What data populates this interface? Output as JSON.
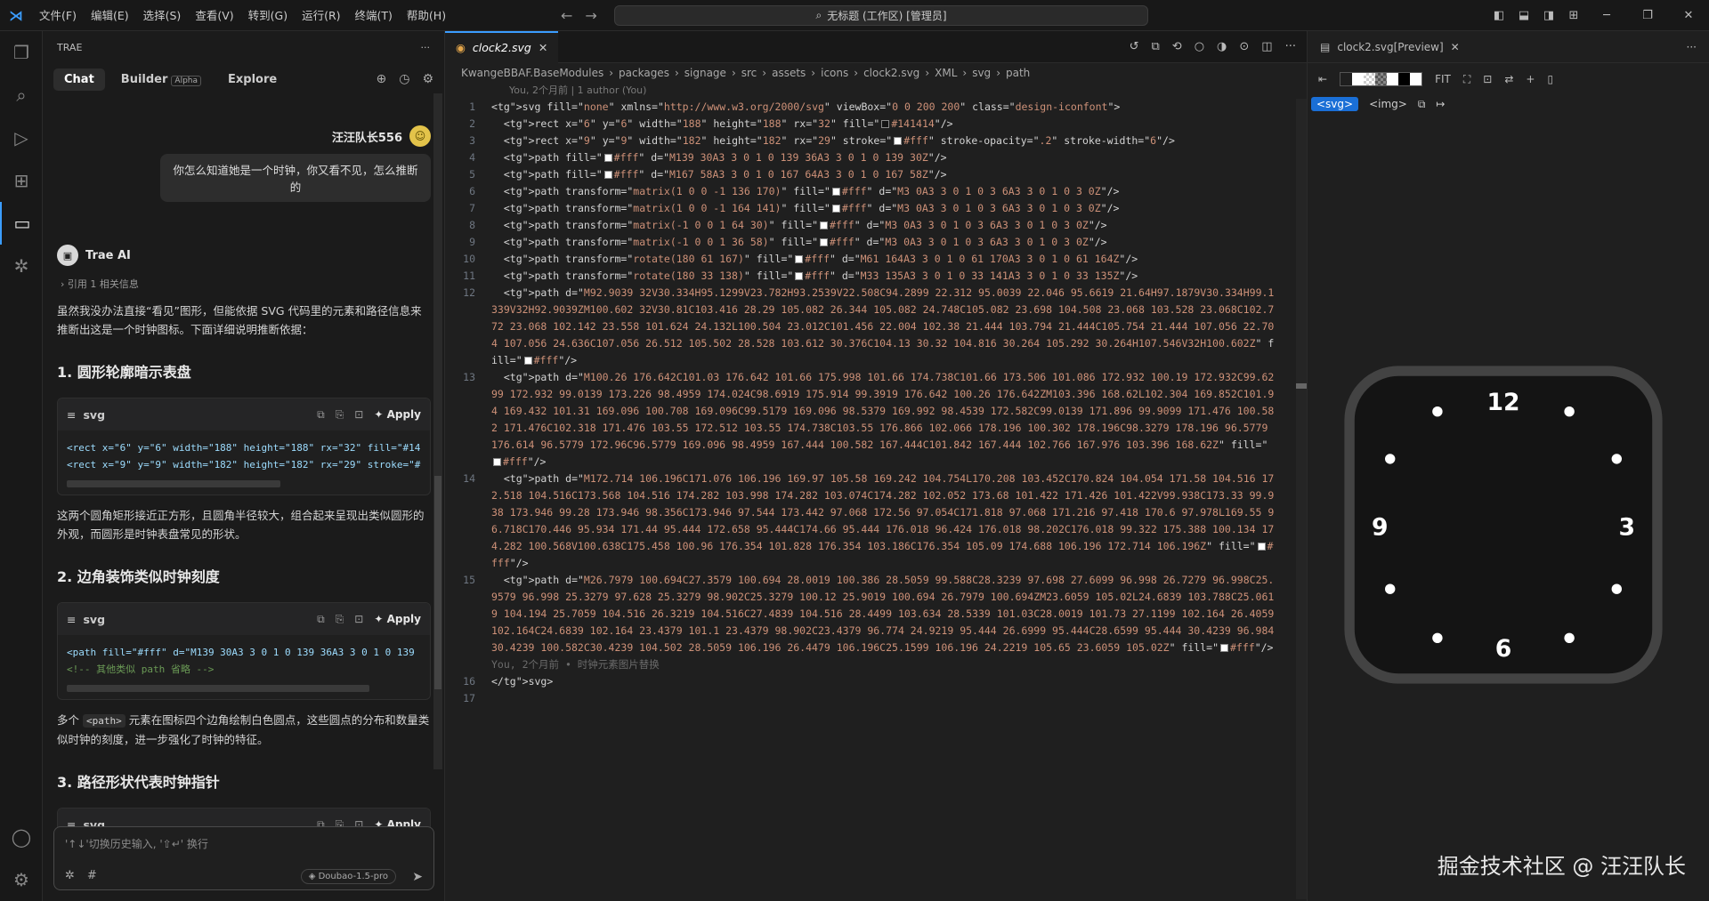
{
  "titlebar": {
    "menu": [
      "文件(F)",
      "编辑(E)",
      "选择(S)",
      "查看(V)",
      "转到(G)",
      "运行(R)",
      "终端(T)",
      "帮助(H)"
    ],
    "search": "无标题 (工作区) [管理员]",
    "search_icon": "search-icon"
  },
  "chat": {
    "header": "TRAE",
    "more": "···",
    "tabs": [
      {
        "label": "Chat"
      },
      {
        "label": "Builder",
        "badge": "Alpha"
      },
      {
        "label": "Explore"
      }
    ],
    "user_name": "汪汪队长556",
    "user_message": "你怎么知道她是一个时钟，你又看不见，怎么推断的",
    "ai_name": "Trae AI",
    "reference": "引用 1 相关信息",
    "intro": "虽然我没办法直接“看见”图形，但能依据 SVG 代码里的元素和路径信息来推断出这是一个时钟图标。下面详细说明推断依据：",
    "sections": [
      {
        "title": "1. 圆形轮廓暗示表盘",
        "lang": "svg",
        "apply": "Apply",
        "code": [
          "<rect x=\"6\" y=\"6\" width=\"188\" height=\"188\" rx=\"32\" fill=\"#14",
          "<rect x=\"9\" y=\"9\" width=\"182\" height=\"182\" rx=\"29\" stroke=\"#"
        ],
        "text": "这两个圆角矩形接近正方形，且圆角半径较大，组合起来呈现出类似圆形的外观，而圆形是时钟表盘常见的形状。"
      },
      {
        "title": "2. 边角装饰类似时钟刻度",
        "lang": "svg",
        "apply": "Apply",
        "code": [
          "<path fill=\"#fff\" d=\"M139 30A3 3 0 1 0 139 36A3 3 0 1 0 139",
          "<!-- 其他类似 path 省略 -->"
        ],
        "text_before": "多个",
        "text_code": "<path>",
        "text_after": "元素在图标四个边角绘制白色圆点，这些圆点的分布和数量类似时钟的刻度，进一步强化了时钟的特征。"
      },
      {
        "title": "3. 路径形状代表时钟指针",
        "lang": "svg",
        "apply": "Apply"
      }
    ],
    "input_placeholder": "'↑↓'切换历史输入, '⇧↵' 换行",
    "model": "Doubao-1.5-pro"
  },
  "editor": {
    "tab": "clock2.svg",
    "breadcrumb": [
      "KwangeBBAF.BaseModules",
      "packages",
      "signage",
      "src",
      "assets",
      "icons",
      "clock2.svg",
      "XML",
      "svg",
      "path"
    ],
    "blame": "You, 2个月前 | 1 author (You)",
    "inline_blame": "You, 2个月前 • 时钟元素图片替换",
    "lines": [
      "<svg fill=\"none\" xmlns=\"http://www.w3.org/2000/svg\" viewBox=\"0 0 200 200\" class=\"design-iconfont\">",
      "  <rect x=\"6\" y=\"6\" width=\"188\" height=\"188\" rx=\"32\" fill=\"#141414\"/>",
      "  <rect x=\"9\" y=\"9\" width=\"182\" height=\"182\" rx=\"29\" stroke=\"#fff\" stroke-opacity=\".2\" stroke-width=\"6\"/>",
      "  <path fill=\"#fff\" d=\"M139 30A3 3 0 1 0 139 36A3 3 0 1 0 139 30Z\"/>",
      "  <path fill=\"#fff\" d=\"M167 58A3 3 0 1 0 167 64A3 3 0 1 0 167 58Z\"/>",
      "  <path transform=\"matrix(1 0 0 -1 136 170)\" fill=\"#fff\" d=\"M3 0A3 3 0 1 0 3 6A3 3 0 1 0 3 0Z\"/>",
      "  <path transform=\"matrix(1 0 0 -1 164 141)\" fill=\"#fff\" d=\"M3 0A3 3 0 1 0 3 6A3 3 0 1 0 3 0Z\"/>",
      "  <path transform=\"matrix(-1 0 0 1 64 30)\" fill=\"#fff\" d=\"M3 0A3 3 0 1 0 3 6A3 3 0 1 0 3 0Z\"/>",
      "  <path transform=\"matrix(-1 0 0 1 36 58)\" fill=\"#fff\" d=\"M3 0A3 3 0 1 0 3 6A3 3 0 1 0 3 0Z\"/>",
      "  <path transform=\"rotate(180 61 167)\" fill=\"#fff\" d=\"M61 164A3 3 0 1 0 61 170A3 3 0 1 0 61 164Z\"/>",
      "  <path transform=\"rotate(180 33 138)\" fill=\"#fff\" d=\"M33 135A3 3 0 1 0 33 141A3 3 0 1 0 33 135Z\"/>",
      "  <path d=\"M92.9039 32V30.334H95.1299V23.782H93.2539V22.508C94.2899 22.312 95.0039 22.046 95.6619 21.64H97.1879V30.334H99.1339V32H92.9039ZM100.602 32V30.81C103.416 28.29 105.082 26.344 105.082 24.748C105.082 23.698 104.508 23.068 103.528 23.068C102.772 23.068 102.142 23.558 101.624 24.132L100.504 23.012C101.456 22.004 102.38 21.444 103.794 21.444C105.754 21.444 107.056 22.704 107.056 24.636C107.056 26.512 105.502 28.528 103.612 30.376C104.13 30.32 104.816 30.264 105.292 30.264H107.546V32H100.602Z\" fill=\"#fff\"/>",
      "  <path d=\"M100.26 176.642C101.03 176.642 101.66 175.998 101.66 174.738C101.66 173.506 101.086 172.932 100.19 172.932C99.6299 172.932 99.0139 173.226 98.4959 174.024C98.6919 175.914 99.3919 176.642 100.26 176.642ZM103.396 168.62L102.304 169.852C101.94 169.432 101.31 169.096 100.708 169.096C99.5179 169.096 98.5379 169.992 98.4539 172.582C99.0139 171.896 99.9099 171.476 100.582 171.476C102.318 171.476 103.55 172.512 103.55 174.738C103.55 176.866 102.066 178.196 100.302 178.196C98.3279 178.196 96.5779 176.614 96.5779 172.96C96.5779 169.096 98.4959 167.444 100.582 167.444C101.842 167.444 102.766 167.976 103.396 168.62Z\" fill=\"#fff\"/>",
      "  <path d=\"M172.714 106.196C171.076 106.196 169.97 105.58 169.242 104.754L170.208 103.452C170.824 104.054 171.58 104.516 172.518 104.516C173.568 104.516 174.282 103.998 174.282 103.074C174.282 102.052 173.68 101.422 171.426 101.422V99.938C173.33 99.938 173.946 99.28 173.946 98.356C173.946 97.544 173.442 97.068 172.56 97.054C171.818 97.068 171.216 97.418 170.6 97.978L169.55 96.718C170.446 95.934 171.44 95.444 172.658 95.444C174.66 95.444 176.018 96.424 176.018 98.202C176.018 99.322 175.388 100.134 174.282 100.568V100.638C175.458 100.96 176.354 101.828 176.354 103.186C176.354 105.09 174.688 106.196 172.714 106.196Z\" fill=\"#fff\"/>",
      "  <path d=\"M26.7979 100.694C27.3579 100.694 28.0019 100.386 28.5059 99.588C28.3239 97.698 27.6099 96.998 26.7279 96.998C25.9579 96.998 25.3279 97.628 25.3279 98.902C25.3279 100.12 25.9019 100.694 26.7979 100.694ZM23.6059 105.02L24.6839 103.788C25.0619 104.194 25.7059 104.516 26.3219 104.516C27.4839 104.516 28.4499 103.634 28.5339 101.03C28.0019 101.73 27.1199 102.164 26.4059 102.164C24.6839 102.164 23.4379 101.1 23.4379 98.902C23.4379 96.774 24.9219 95.444 26.6999 95.444C28.6599 95.444 30.4239 96.984 30.4239 100.582C30.4239 104.502 28.5059 106.196 26.4479 106.196C25.1599 106.196 24.2219 105.65 23.6059 105.02Z\" fill=\"#fff\"/>",
      "</svg>",
      ""
    ]
  },
  "preview": {
    "tab": "clock2.svg[Preview]",
    "fit": "FIT",
    "pill_svg": "<svg>",
    "pill_img": "<img>",
    "clock": {
      "n12": "12",
      "n3": "3",
      "n6": "6",
      "n9": "9",
      "bg": "#141414",
      "stroke": "#ffffff"
    }
  },
  "watermark": "掘金技术社区 @ 汪汪队长"
}
